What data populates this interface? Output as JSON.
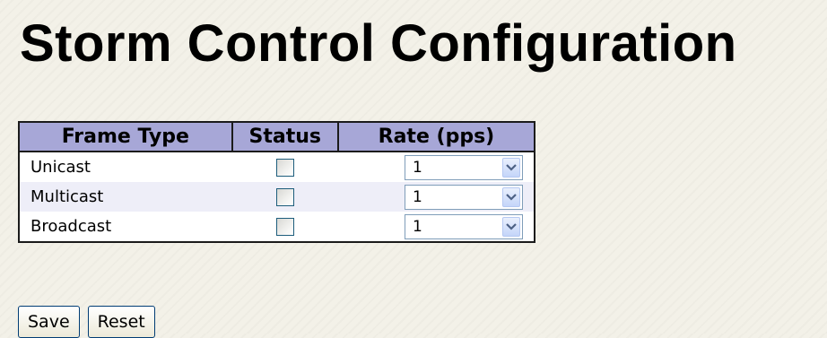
{
  "page": {
    "title": "Storm Control Configuration"
  },
  "table": {
    "headers": {
      "frame_type": "Frame Type",
      "status": "Status",
      "rate": "Rate (pps)"
    },
    "rows": [
      {
        "frame_type": "Unicast",
        "status_checked": false,
        "rate": "1"
      },
      {
        "frame_type": "Multicast",
        "status_checked": false,
        "rate": "1"
      },
      {
        "frame_type": "Broadcast",
        "status_checked": false,
        "rate": "1"
      }
    ]
  },
  "buttons": {
    "save": "Save",
    "reset": "Reset"
  },
  "colors": {
    "header_bg": "#a7a7d7",
    "row_alt_bg": "#eeeef8",
    "page_bg": "#f3f1e8"
  },
  "icons": {
    "select_arrow": "chevron-down-icon"
  }
}
